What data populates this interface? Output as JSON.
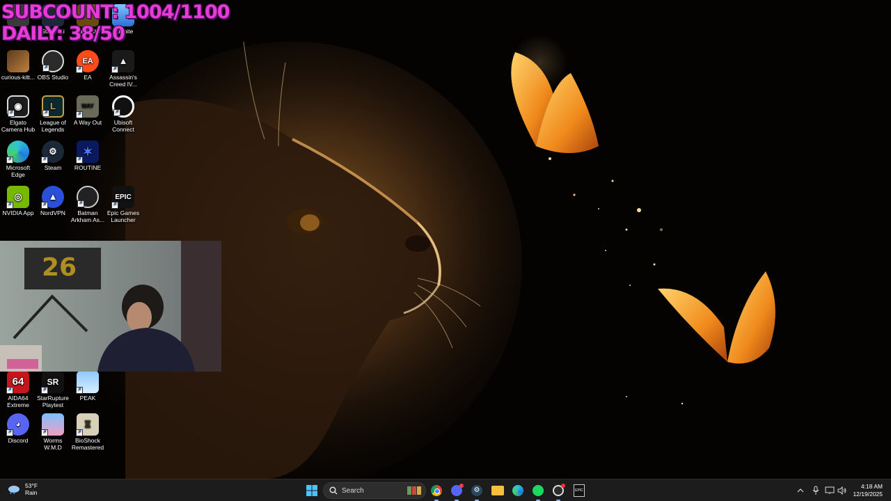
{
  "overlay": {
    "subcount": "SUBCOUNT: 1004/1100",
    "daily": "DAILY: 38/50"
  },
  "desktop": {
    "icons": [
      {
        "name": "ea-overlap",
        "label": ""
      },
      {
        "name": "steam-link",
        "label": "Steam Li"
      },
      {
        "name": "rave",
        "label": "ave Cl"
      },
      {
        "name": "fortnite",
        "label": "Fortnite"
      },
      {
        "name": "curious-kitt",
        "label": "curious-kitt..."
      },
      {
        "name": "obs-studio",
        "label": "OBS Studio"
      },
      {
        "name": "ea",
        "label": "EA"
      },
      {
        "name": "assassins-creed",
        "label": "Assassin's Creed IV..."
      },
      {
        "name": "elgato",
        "label": "Elgato Camera Hub"
      },
      {
        "name": "league",
        "label": "League of Legends"
      },
      {
        "name": "a-way-out",
        "label": "A Way Out"
      },
      {
        "name": "ubisoft",
        "label": "Ubisoft Connect"
      },
      {
        "name": "edge",
        "label": "Microsoft Edge"
      },
      {
        "name": "steam",
        "label": "Steam"
      },
      {
        "name": "routine",
        "label": "ROUTINE"
      },
      {
        "name": "nvidia",
        "label": "NVIDIA App"
      },
      {
        "name": "nordvpn",
        "label": "NordVPN"
      },
      {
        "name": "batman",
        "label": "Batman Arkham As..."
      },
      {
        "name": "epic",
        "label": "Epic Games Launcher"
      },
      {
        "name": "aida64",
        "label": "AIDA64 Extreme"
      },
      {
        "name": "starrupture",
        "label": "StarRupture Playtest"
      },
      {
        "name": "peak",
        "label": "PEAK"
      },
      {
        "name": "discord",
        "label": "Discord"
      },
      {
        "name": "worms",
        "label": "Worms W.M.D"
      },
      {
        "name": "bioshock",
        "label": "BioShock Remastered"
      }
    ]
  },
  "taskbar": {
    "weather_temp": "53°F",
    "weather_cond": "Rain",
    "search_placeholder": "Search",
    "time": "4:18 AM",
    "date": "12/19/2025"
  },
  "colors": {
    "overlay_text": "#e63bd6",
    "taskbar_bg": "#1c1c1c",
    "accent": "#8ab4ff"
  }
}
